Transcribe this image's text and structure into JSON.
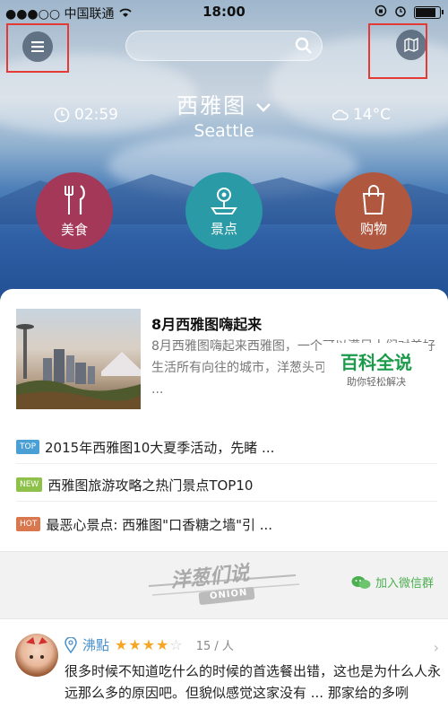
{
  "status_bar": {
    "carrier": "中国联通",
    "time": "18:00"
  },
  "header": {
    "city_cn": "西雅图",
    "city_en": "Seattle",
    "local_time": "02:59",
    "temperature": "14°C"
  },
  "categories": [
    {
      "label": "美食",
      "icon": "fork-knife-icon",
      "color": "#a43858"
    },
    {
      "label": "景点",
      "icon": "map-pin-icon",
      "color": "#2a9aa6"
    },
    {
      "label": "购物",
      "icon": "shopping-bag-icon",
      "color": "#b0583f"
    }
  ],
  "feature": {
    "title": "8月西雅图嗨起来",
    "desc": "8月西雅图嗨起来西雅图，一个可以满足人们对美好生活所有向往的城市，洋葱头可是想去很久了，特 ..."
  },
  "news": [
    {
      "tag": "TOP",
      "tag_color": "#4a9fd4",
      "text": "2015年西雅图10大夏季活动，先睹 ..."
    },
    {
      "tag": "NEW",
      "tag_color": "#8dc149",
      "text": "西雅图旅游攻略之热门景点TOP10"
    },
    {
      "tag": "HOT",
      "tag_color": "#d9774e",
      "text": "最恶心景点: 西雅图\"口香糖之墙\"引 ..."
    }
  ],
  "onion": {
    "logo_text": "洋葱们说",
    "logo_sub": "ONION",
    "wechat_label": "加入微信群"
  },
  "review": {
    "place": "沸點",
    "rating": 4,
    "count": "15 / 人",
    "text": "很多时候不知道吃什么的时候的首选餐出错，这也是为什么人永远那么多的原因吧。但貌似感觉这家没有 ... 那家给的多咧"
  },
  "watermark": {
    "main": "百科全说",
    "sub": "助你轻松解决"
  }
}
